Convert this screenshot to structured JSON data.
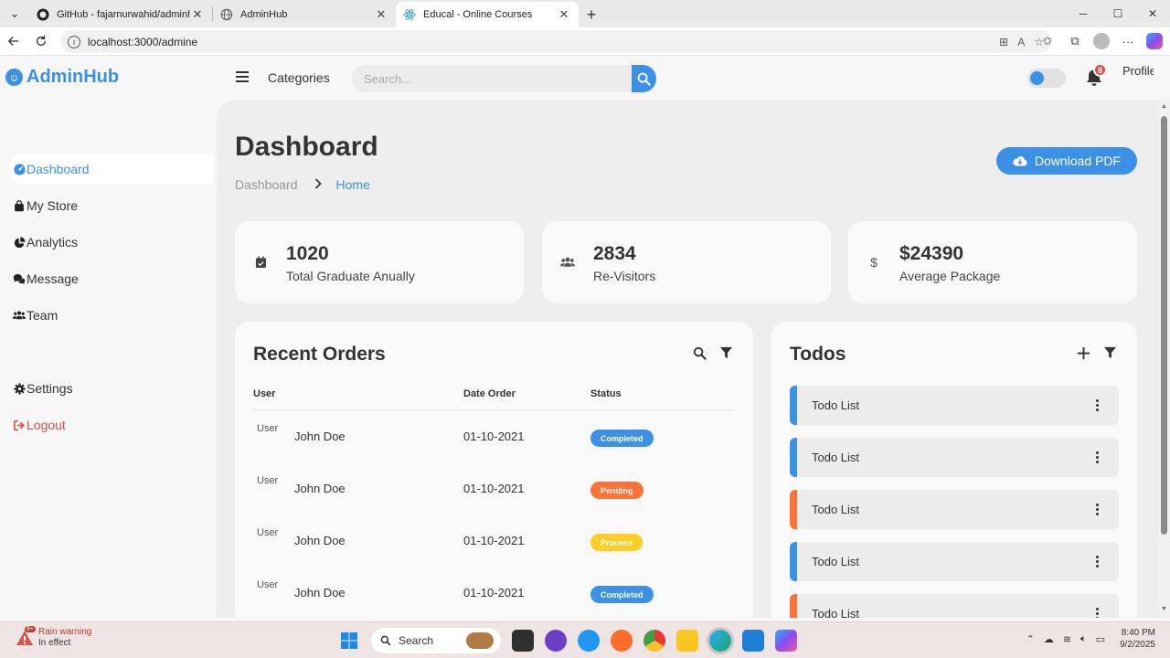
{
  "browser": {
    "tabs": [
      {
        "title": "GitHub - fajarnurwahid/adminhub",
        "active": false
      },
      {
        "title": "AdminHub",
        "active": false
      },
      {
        "title": "Educal - Online Courses",
        "active": true
      }
    ],
    "url": "localhost:3000/admine"
  },
  "header": {
    "brand": "AdminHub",
    "categories": "Categories",
    "search_placeholder": "Search...",
    "notification_count": "8",
    "profile_alt": "Profile"
  },
  "sidebar": {
    "items": [
      {
        "label": "Dashboard",
        "icon": "dashboard-icon",
        "active": true
      },
      {
        "label": "My Store",
        "icon": "shopping-bag-icon"
      },
      {
        "label": "Analytics",
        "icon": "pie-chart-icon"
      },
      {
        "label": "Message",
        "icon": "message-icon"
      },
      {
        "label": "Team",
        "icon": "team-icon"
      }
    ],
    "settings": "Settings",
    "logout": "Logout"
  },
  "main": {
    "title": "Dashboard",
    "breadcrumb": [
      "Dashboard",
      "Home"
    ],
    "download_label": "Download PDF",
    "stats": [
      {
        "value": "1020",
        "label": "Total Graduate Anually",
        "icon": "calendar-check-icon"
      },
      {
        "value": "2834",
        "label": "Re-Visitors",
        "icon": "group-icon"
      },
      {
        "value": "$24390",
        "label": "Average Package",
        "icon": "dollar-icon"
      }
    ],
    "orders": {
      "title": "Recent Orders",
      "columns": [
        "User",
        "Date Order",
        "Status"
      ],
      "rows": [
        {
          "img_alt": "User",
          "name": "John Doe",
          "date": "01-10-2021",
          "status": "Completed"
        },
        {
          "img_alt": "User",
          "name": "John Doe",
          "date": "01-10-2021",
          "status": "Pending"
        },
        {
          "img_alt": "User",
          "name": "John Doe",
          "date": "01-10-2021",
          "status": "Process"
        },
        {
          "img_alt": "User",
          "name": "John Doe",
          "date": "01-10-2021",
          "status": "Completed"
        }
      ]
    },
    "todos": {
      "title": "Todos",
      "items": [
        {
          "label": "Todo List",
          "state": "completed"
        },
        {
          "label": "Todo List",
          "state": "completed"
        },
        {
          "label": "Todo List",
          "state": "not-completed"
        },
        {
          "label": "Todo List",
          "state": "completed"
        },
        {
          "label": "Todo List",
          "state": "not-completed"
        }
      ]
    }
  },
  "colors": {
    "accent": "#3c91e6",
    "completed": "#3c91e6",
    "pending": "#fd7238",
    "process": "#ffce26",
    "danger": "#db504a"
  },
  "taskbar": {
    "weather_title": "Rain warning",
    "weather_sub": "In effect",
    "weather_badge": "9+",
    "search_label": "Search",
    "time": "8:40 PM",
    "date": "9/2/2025"
  }
}
